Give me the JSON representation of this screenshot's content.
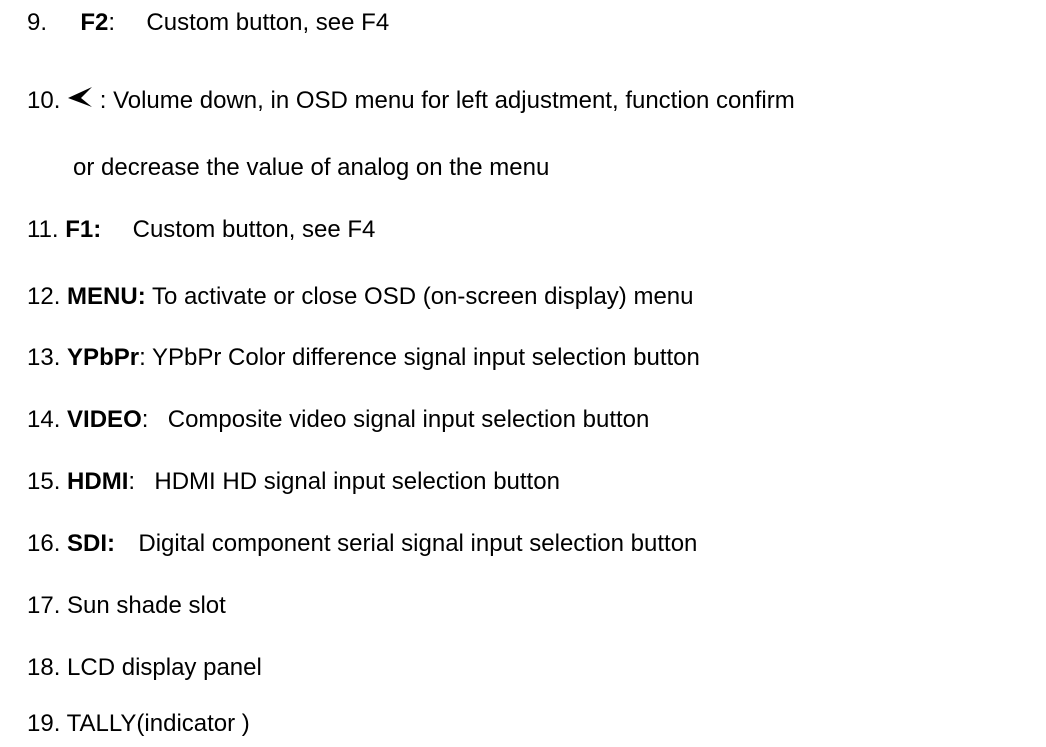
{
  "items": [
    {
      "number": "9.",
      "key": "F2",
      "sep": ":",
      "text": "Custom button, see F4"
    },
    {
      "number": "10.",
      "icon": "left-arrow-icon",
      "sep": ":",
      "text": "Volume down, in OSD menu for left adjustment, function confirm",
      "continuation": "or decrease the value of analog on the menu"
    },
    {
      "number": "11.",
      "key": "F1:",
      "text": "Custom button, see F4"
    },
    {
      "number": "12.",
      "key": "MENU:",
      "text": "To activate or close OSD (on-screen display) menu"
    },
    {
      "number": "13.",
      "key": "YPbPr",
      "sep": ":",
      "text": "YPbPr Color difference signal input selection button"
    },
    {
      "number": "14.",
      "key": "VIDEO",
      "sep": ":",
      "text": "Composite video signal input selection button"
    },
    {
      "number": "15.",
      "key": "HDMI",
      "sep": ":",
      "text": "HDMI HD signal input selection button"
    },
    {
      "number": "16.",
      "key": "SDI:",
      "text": "Digital component serial signal input selection button"
    },
    {
      "number": "17.",
      "text": "Sun shade slot"
    },
    {
      "number": "18.",
      "text": "LCD display panel"
    },
    {
      "number": "19.",
      "text": "TALLY(indicator )"
    }
  ]
}
